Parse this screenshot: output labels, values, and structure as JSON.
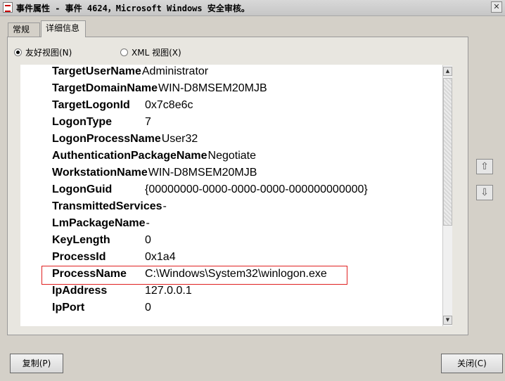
{
  "window": {
    "title": "事件属性 - 事件 4624，Microsoft Windows 安全审核。",
    "close_glyph": "✕"
  },
  "tabs": [
    {
      "label": "常规"
    },
    {
      "label": "详细信息"
    }
  ],
  "view": {
    "friendly_label": "友好视图(N)",
    "xml_label": "XML 视图(X)",
    "selected": "friendly"
  },
  "fields": [
    {
      "key": "TargetUserName",
      "value": "Administrator"
    },
    {
      "key": "TargetDomainName",
      "value": "WIN-D8MSEM20MJB"
    },
    {
      "key": "TargetLogonId",
      "value": "0x7c8e6c"
    },
    {
      "key": "LogonType",
      "value": "7"
    },
    {
      "key": "LogonProcessName",
      "value": "User32"
    },
    {
      "key": "AuthenticationPackageName",
      "value": "Negotiate"
    },
    {
      "key": "WorkstationName",
      "value": "WIN-D8MSEM20MJB"
    },
    {
      "key": "LogonGuid",
      "value": "{00000000-0000-0000-0000-000000000000}"
    },
    {
      "key": "TransmittedServices",
      "value": "-"
    },
    {
      "key": "LmPackageName",
      "value": "-"
    },
    {
      "key": "KeyLength",
      "value": "0"
    },
    {
      "key": "ProcessId",
      "value": "0x1a4"
    },
    {
      "key": "ProcessName",
      "value": "C:\\Windows\\System32\\winlogon.exe"
    },
    {
      "key": "IpAddress",
      "value": "127.0.0.1"
    },
    {
      "key": "IpPort",
      "value": "0"
    }
  ],
  "highlighted_field": "ProcessName",
  "buttons": {
    "copy": "复制(P)",
    "close": "关闭(C)"
  },
  "icons": {
    "scroll_up": "▲",
    "scroll_down": "▼",
    "nav_up": "⇧",
    "nav_down": "⇩"
  },
  "colors": {
    "highlight_border": "#e02020"
  }
}
